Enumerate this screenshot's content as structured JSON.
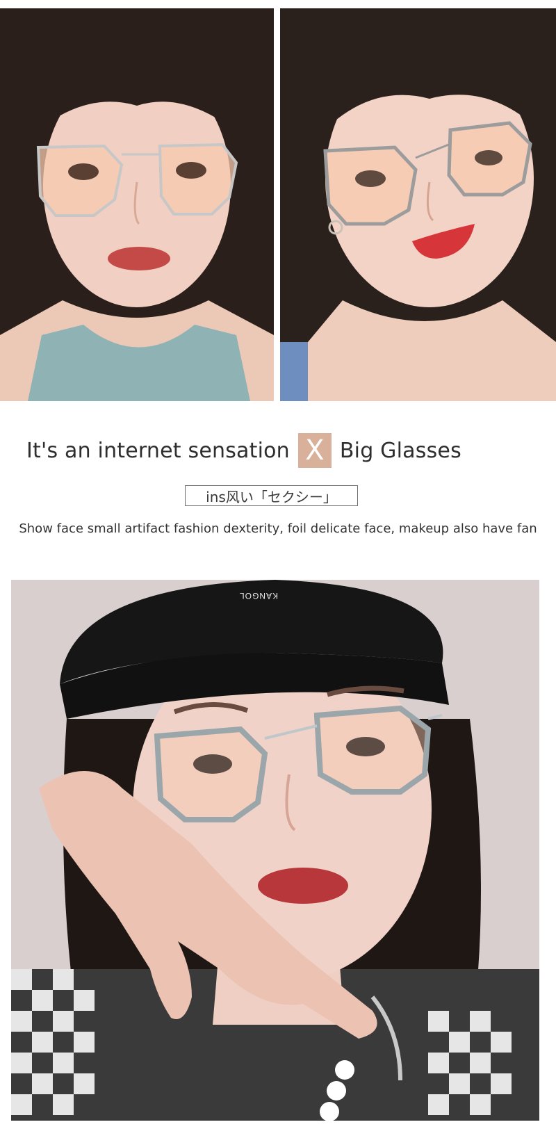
{
  "headline": {
    "part1": "It's an internet sensation",
    "mark": "X",
    "part2": "Big Glasses"
  },
  "subtag": "ins风い「セクシー」",
  "tagline": "Show face small artifact fashion dexterity, foil delicate face, makeup also have fan",
  "photos": {
    "hat_text": "KANGOL"
  },
  "colors": {
    "accent": "#d9b09a",
    "skin": "#f1cfc2",
    "hair": "#1f1714",
    "lens_tint": "#f6c9ae",
    "top_fabric": "#8fb3b5"
  }
}
